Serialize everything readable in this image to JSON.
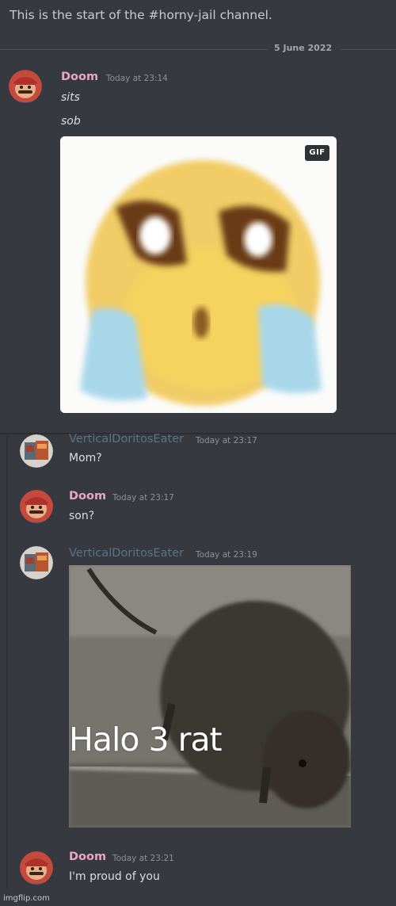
{
  "channel": {
    "start_text": "This is the start of the #horny-jail channel."
  },
  "date_divider": "5 June 2022",
  "messages": [
    {
      "author": "Doom",
      "timestamp": "Today at 23:14",
      "lines": [
        "sits",
        "sob"
      ],
      "gif_badge": "GIF"
    },
    {
      "author": "VerticalDoritosEater",
      "timestamp": "Today at 23:17",
      "lines": [
        "Mom?"
      ]
    },
    {
      "author": "Doom",
      "timestamp": "Today at 23:17",
      "lines": [
        "son?"
      ]
    },
    {
      "author": "VerticalDoritosEater",
      "timestamp": "Today at 23:19",
      "image_caption": "Halo 3 rat"
    },
    {
      "author": "Doom",
      "timestamp": "Today at 23:21",
      "lines": [
        "I'm proud of you"
      ]
    }
  ],
  "watermark": "imgflip.com",
  "colors": {
    "background": "#36393f",
    "doom_name": "#e9a6c6",
    "vde_name": "#5f7182",
    "timestamp": "#8e9297",
    "message_text": "#dcddde"
  },
  "icons": {
    "doom_avatar": "mario-avatar-icon",
    "vde_avatar": "doritos-avatar-icon"
  }
}
